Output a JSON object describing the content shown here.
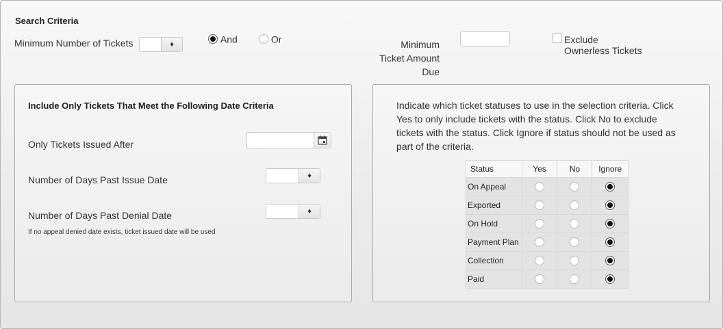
{
  "search": {
    "title": "Search Criteria",
    "min_tickets_label": "Minimum Number of Tickets",
    "min_tickets_value": "",
    "logic_options": [
      {
        "label": "And",
        "selected": true
      },
      {
        "label": "Or",
        "selected": false
      }
    ],
    "min_amount_label_line1": "Minimum",
    "min_amount_label_line2": "Ticket Amount",
    "min_amount_label_line3": "Due",
    "min_amount_value": "",
    "exclude_label_line1": "Exclude",
    "exclude_label_line2": "Ownerless Tickets",
    "exclude_checked": false
  },
  "date_panel": {
    "title": "Include Only Tickets That Meet the Following Date Criteria",
    "issued_after_label": "Only Tickets Issued After",
    "issued_after_value": "",
    "days_past_issue_label": "Number of Days Past Issue Date",
    "days_past_issue_value": "",
    "days_past_denial_label": "Number of Days Past Denial Date",
    "days_past_denial_value": "",
    "note": "If no appeal denied date exists, ticket issued date will be used"
  },
  "status_panel": {
    "instructions": "Indicate which ticket statuses to use in the selection criteria. Click Yes to only include tickets with the status. Click No to exclude tickets with the status. Click Ignore if status should not be used as part of the criteria.",
    "columns": [
      "Status",
      "Yes",
      "No",
      "Ignore"
    ],
    "rows": [
      {
        "status": "On Appeal",
        "selected": "Ignore"
      },
      {
        "status": "Exported",
        "selected": "Ignore"
      },
      {
        "status": "On Hold",
        "selected": "Ignore"
      },
      {
        "status": "Payment Plan",
        "selected": "Ignore"
      },
      {
        "status": "Collection",
        "selected": "Ignore"
      },
      {
        "status": "Paid",
        "selected": "Ignore"
      }
    ]
  },
  "icons": {
    "spinner": "spinner-arrows-icon",
    "calendar": "calendar-icon"
  }
}
